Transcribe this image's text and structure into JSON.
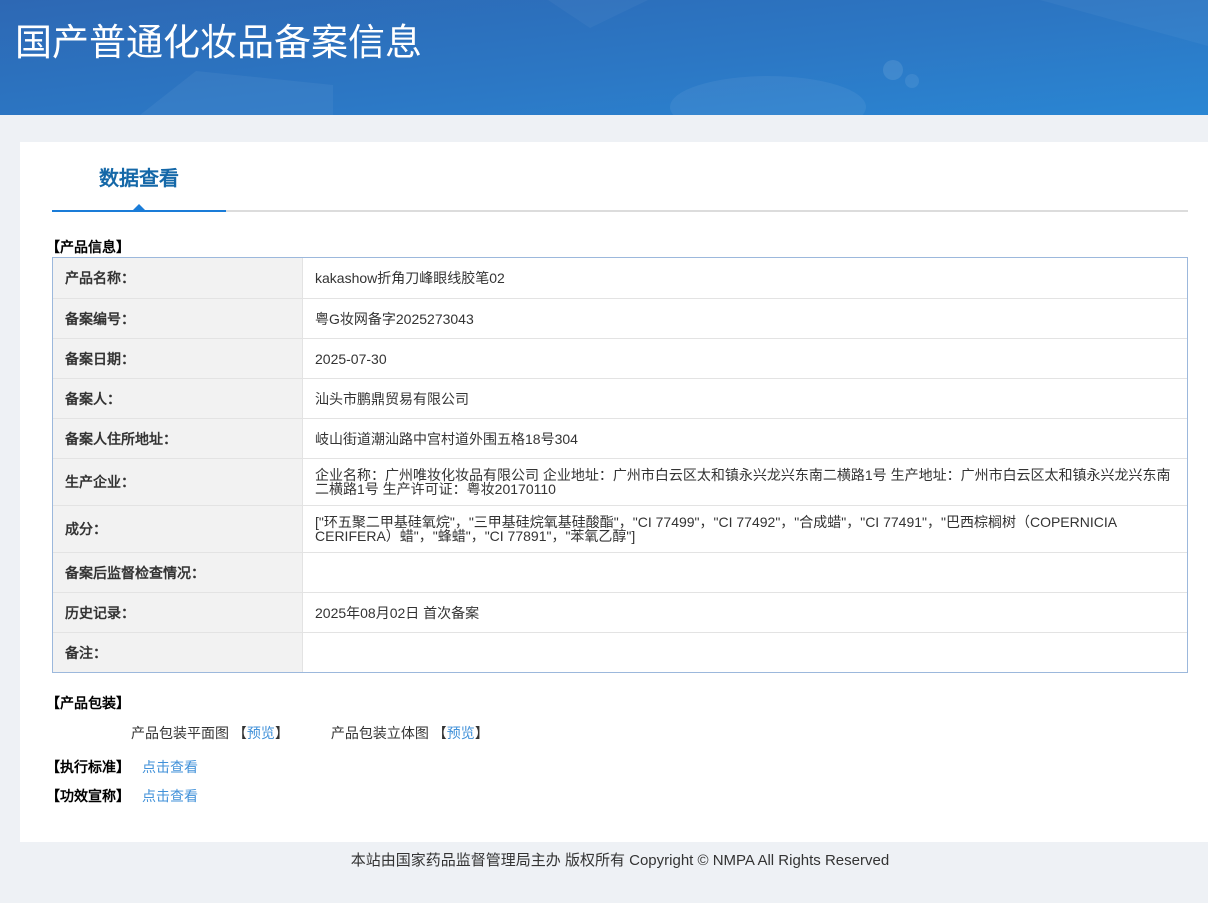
{
  "header": {
    "title": "国产普通化妆品备案信息"
  },
  "tabs": {
    "active_label": "数据查看"
  },
  "product_info": {
    "section_title": "【产品信息】",
    "rows": [
      {
        "label": "产品名称：",
        "value": "kakashow折角刀峰眼线胶笔02"
      },
      {
        "label": "备案编号：",
        "value": "粤G妆网备字2025273043"
      },
      {
        "label": "备案日期：",
        "value": "2025-07-30"
      },
      {
        "label": "备案人：",
        "value": "汕头市鹏鼎贸易有限公司"
      },
      {
        "label": "备案人住所地址：",
        "value": "岐山街道潮汕路中宫村道外围五格18号304"
      },
      {
        "label": "生产企业：",
        "value": "企业名称：广州唯妆化妆品有限公司 企业地址：广州市白云区太和镇永兴龙兴东南二横路1号 生产地址：广州市白云区太和镇永兴龙兴东南二横路1号 生产许可证：粤妆20170110"
      },
      {
        "label": "成分：",
        "value": "[\"环五聚二甲基硅氧烷\"，\"三甲基硅烷氧基硅酸酯\"，\"CI 77499\"，\"CI 77492\"，\"合成蜡\"，\"CI 77491\"，\"巴西棕榈树（COPERNICIA CERIFERA）蜡\"，\"蜂蜡\"，\"CI 77891\"，\"苯氧乙醇\"]"
      },
      {
        "label": "备案后监督检查情况：",
        "value": ""
      },
      {
        "label": "历史记录：",
        "value": "2025年08月02日 首次备案"
      },
      {
        "label": "备注：",
        "value": ""
      }
    ]
  },
  "packaging": {
    "section_title": "【产品包装】",
    "items": [
      {
        "label": "产品包装平面图 ",
        "open": "【",
        "link": "预览",
        "close": "】"
      },
      {
        "label": "产品包装立体图 ",
        "open": "【",
        "link": "预览",
        "close": "】"
      }
    ]
  },
  "standard": {
    "label": "【执行标准】",
    "link": "点击查看"
  },
  "efficacy": {
    "label": "【功效宣称】",
    "link": "点击查看"
  },
  "footer": {
    "text": "本站由国家药品监督管理局主办 版权所有 Copyright © NMPA All Rights Reserved"
  },
  "colors": {
    "banner_gradient_start": "#2b65af",
    "banner_gradient_end": "#3389da",
    "tab_text": "#1568a8",
    "tab_underline": "#1a7cd8",
    "table_outer_border": "#9cb8dc",
    "table_inner_border": "#e3e3e3",
    "label_cell_bg": "#f2f2f2",
    "link_blue": "#4191d9",
    "page_bg": "#eef1f5"
  }
}
